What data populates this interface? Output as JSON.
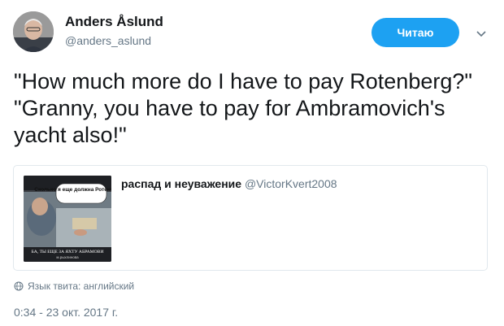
{
  "author": {
    "name": "Anders Åslund",
    "handle": "@anders_aslund"
  },
  "follow_button": {
    "label": "Читаю"
  },
  "menu": {
    "icon": "chevron-down-icon"
  },
  "tweet": {
    "text": "\"How much more do I have to pay Rotenberg?\" \"Granny, you have to pay for Ambramovich's yacht also!\""
  },
  "quoted": {
    "name": "распад и неуважение",
    "handle": "@VictorKvert2008",
    "media": {
      "bubble_text": "Сколько я еще должна Ротенбергу?",
      "caption": "БА, ТЫ ЕЩЕ ЗА ЯХТУ АБРАМОВИ",
      "subcaption": "м.рыхлинова"
    }
  },
  "language": {
    "icon": "globe-icon",
    "text": "Язык твита: английский"
  },
  "timestamp": "0:34 - 23 окт. 2017 г.",
  "colors": {
    "accent": "#1da1f2",
    "secondary_text": "#657786",
    "border": "#e1e8ed"
  }
}
